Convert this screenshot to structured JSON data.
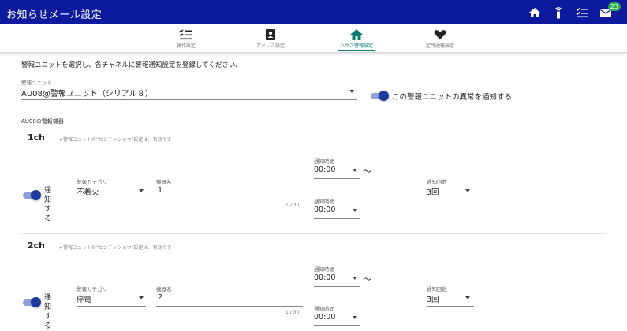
{
  "header": {
    "title": "お知らせメール設定",
    "badge_count": "23"
  },
  "tabs": [
    {
      "label": "操作設定",
      "icon": "checklist-icon",
      "active": false
    },
    {
      "label": "アドレス設定",
      "icon": "address-book-icon",
      "active": false
    },
    {
      "label": "ハウス警報設定",
      "icon": "house-icon",
      "active": true
    },
    {
      "label": "定時通報設定",
      "icon": "heart-icon",
      "active": false
    }
  ],
  "intro": "警報ユニットを選択し、各チャネルに警報通知設定を登録してください。",
  "unit": {
    "label": "警報ユニット",
    "value": "AU08@警報ユニット（シリアル８）",
    "notify_label": "この警報ユニットの異常を通知する"
  },
  "devices_title": "AU08の警報機器",
  "channels": [
    {
      "name": "1ch",
      "note": "✔警報ユニットの\"センテンショウ\"設定は、有効です",
      "notify_label": "通知する",
      "category_label": "警報カテゴリ",
      "category": "不着火",
      "device_label": "機器名",
      "device": "1",
      "counter": "1 / 30",
      "time_label": "通知時間",
      "time_from": "00:00",
      "tilde": "～",
      "time_to": "00:00",
      "count_label": "通知回数",
      "count": "3回"
    },
    {
      "name": "2ch",
      "note": "✔警報ユニットの\"センテンショウ\"設定は、有効です",
      "notify_label": "通知する",
      "category_label": "警報カテゴリ",
      "category": "停電",
      "device_label": "機器名",
      "device": "2",
      "counter": "1 / 30",
      "time_label": "通知時間",
      "time_from": "00:00",
      "tilde": "～",
      "time_to": "00:00",
      "count_label": "通知回数",
      "count": "3回"
    }
  ],
  "colors": {
    "header_bg": "#0d1a9e",
    "accent": "#0c7a73",
    "toggle": "#1e3a9e",
    "badge": "#2fa84f"
  }
}
